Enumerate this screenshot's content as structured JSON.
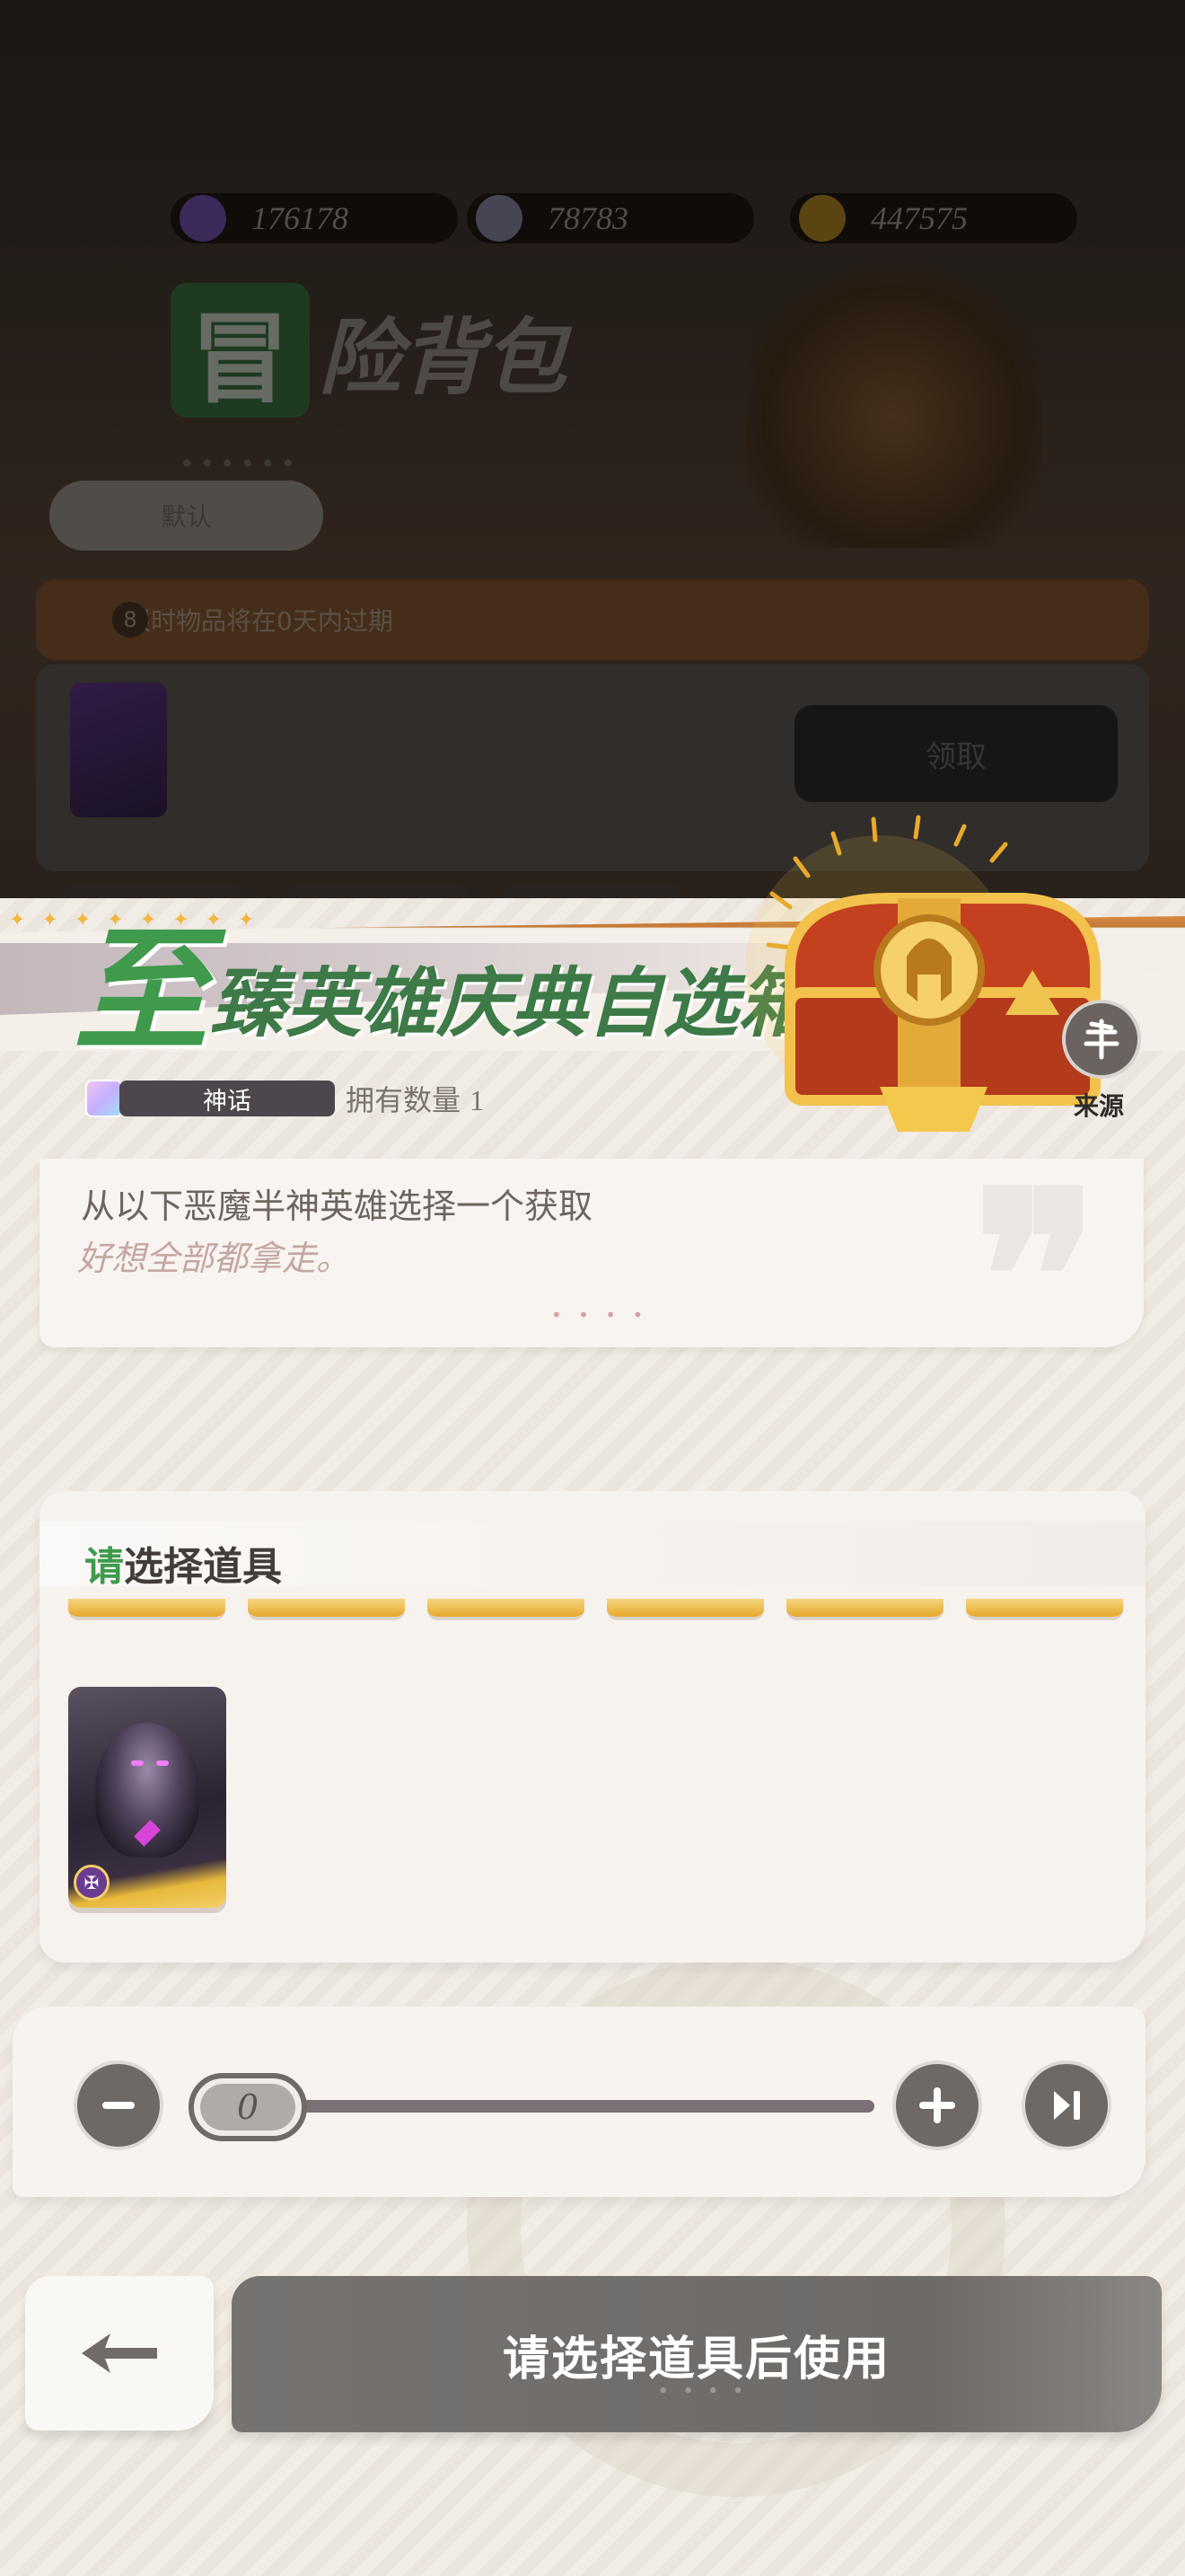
{
  "background": {
    "resources": [
      {
        "icon": "purple-crystal-icon",
        "value": "176178"
      },
      {
        "icon": "diamond-icon",
        "value": "78783"
      },
      {
        "icon": "gold-coin-icon",
        "value": "447575"
      }
    ],
    "title_first": "冒",
    "title_rest": "险背包",
    "pill_label": "默认",
    "banner_num": "8",
    "banner_text": "限时物品将在0天内过期",
    "button_label": "领取"
  },
  "item": {
    "title_first": "至",
    "title_rest": "臻英雄庆典自选箱",
    "rarity": "神话",
    "owned_label": "拥有数量",
    "owned_count": "1",
    "source_label": "来源",
    "description": "从以下恶魔半神英雄选择一个获取",
    "flavor": "好想全部都拿走。"
  },
  "select": {
    "title_highlight": "请",
    "title_rest": "选择道具",
    "heroes": [
      {
        "name": "demon-demigod-hero",
        "badge_icon": "demon-faction-icon"
      }
    ]
  },
  "quantity": {
    "value": "0",
    "minus_icon": "minus-icon",
    "plus_icon": "plus-icon",
    "max_icon": "skip-to-max-icon"
  },
  "actions": {
    "back_icon": "back-arrow-icon",
    "use_label": "请选择道具后使用"
  },
  "colors": {
    "accent_green": "#3f9a4c",
    "button_gray": "#6f6a68",
    "panel": "#f6f2ee"
  }
}
